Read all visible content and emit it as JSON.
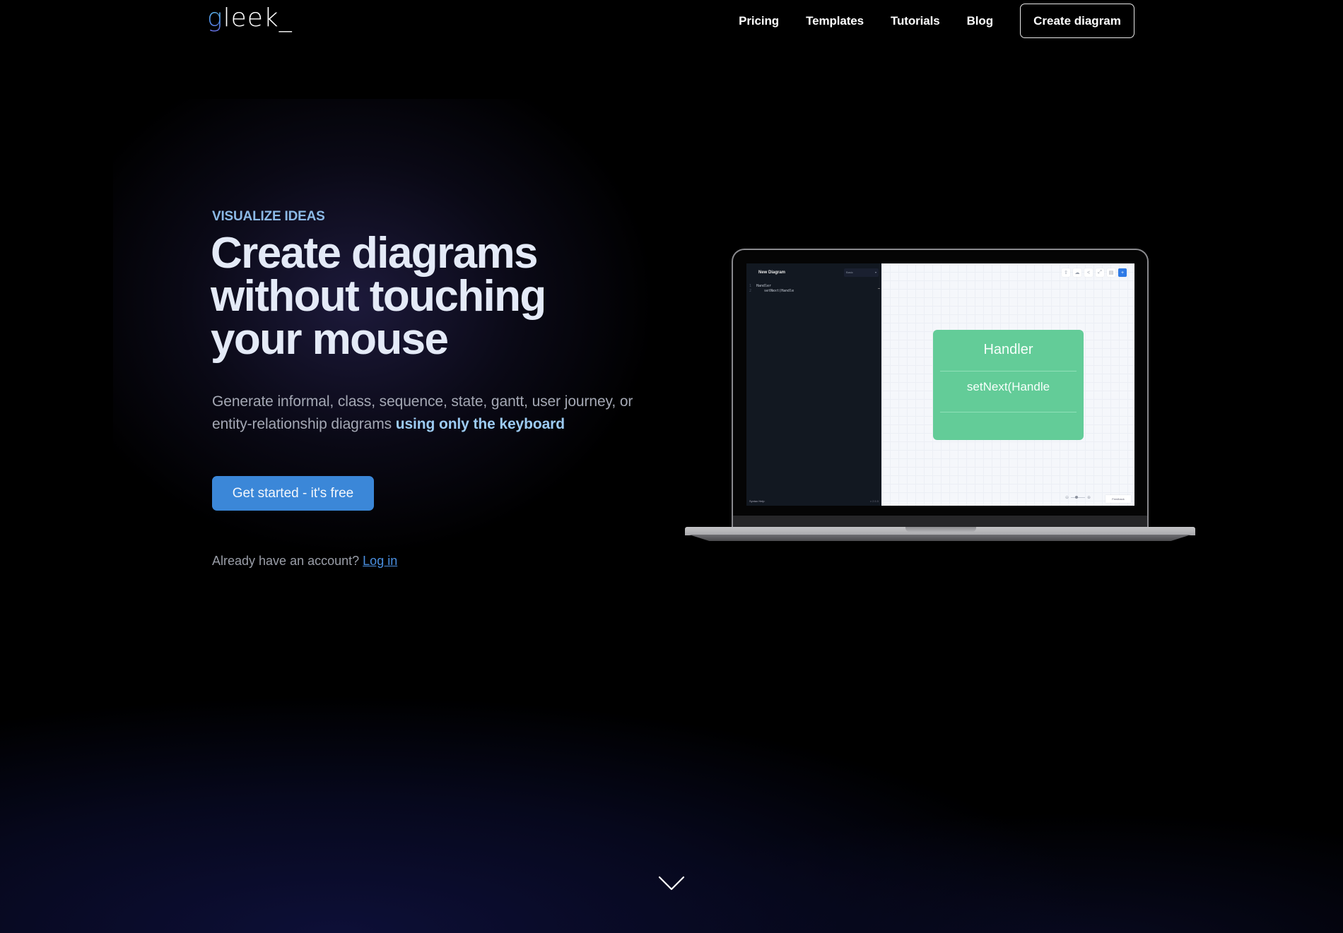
{
  "brand": {
    "logo_first": "g",
    "logo_rest": "leek_"
  },
  "nav": {
    "links": [
      {
        "label": "Pricing"
      },
      {
        "label": "Templates"
      },
      {
        "label": "Tutorials"
      },
      {
        "label": "Blog"
      }
    ],
    "create_button": "Create diagram"
  },
  "hero": {
    "eyebrow": "VISUALIZE IDEAS",
    "headline_lines": [
      "Create diagrams",
      "without touching",
      "your mouse"
    ],
    "subtext_plain": "Generate informal, class, sequence, state, gantt, user journey, or entity-relationship diagrams ",
    "subtext_accent": "using only the keyboard",
    "cta_label": "Get started - it's free",
    "login_prompt": "Already have an account?",
    "login_link": "Log in"
  },
  "mockup": {
    "editor": {
      "title": "New Diagram",
      "style_select": "Basic",
      "code_lines": [
        {
          "num": "1",
          "text": "Handler"
        },
        {
          "num": "2",
          "text": "setNext(Handle"
        }
      ],
      "footer_left": "Syntax Help",
      "footer_right": "v 2.5.5"
    },
    "canvas": {
      "toolbar_icons": [
        "rocket-icon",
        "cloud-download-icon",
        "share-icon",
        "fullscreen-icon",
        "layout-icon",
        "plus-icon"
      ],
      "card_title": "Handler",
      "card_method": "setNext(Handle",
      "zoom_level": 0.4,
      "feedback_label": "Feedback"
    }
  },
  "colors": {
    "accent_blue": "#3b87d8",
    "eyebrow": "#8cb9e6",
    "keyboard_accent": "#9ccbf2",
    "uml_green": "#63cc98",
    "link_blue": "#4a8fe0"
  }
}
